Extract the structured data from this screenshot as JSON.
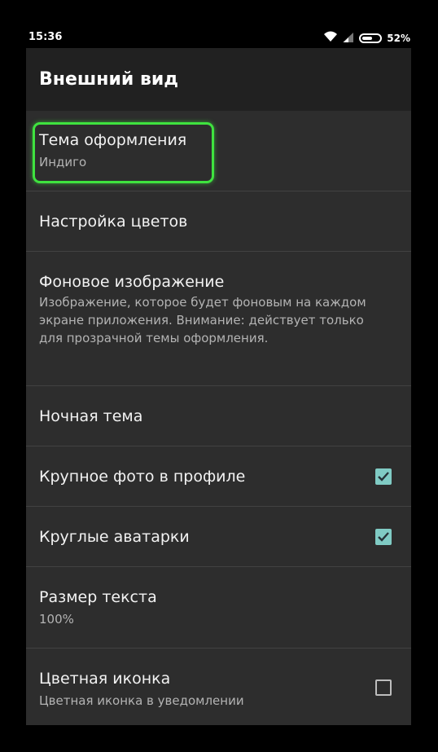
{
  "status_bar": {
    "time": "15:36",
    "battery": "52%"
  },
  "app_bar": {
    "title": "Внешний вид"
  },
  "preferences": [
    {
      "title": "Тема оформления",
      "summary": "Индиго"
    },
    {
      "title": "Настройка цветов"
    },
    {
      "title": "Фоновое изображение",
      "summary": "Изображение, которое будет фоновым на каждом экране приложения. Внимание: действует только для прозрачной темы оформления."
    },
    {
      "title": "Ночная тема"
    },
    {
      "title": "Крупное фото в профиле",
      "checked": true
    },
    {
      "title": "Круглые аватарки",
      "checked": true
    },
    {
      "title": "Размер текста",
      "summary": "100%"
    },
    {
      "title": "Цветная иконка",
      "summary": "Цветная иконка в уведомлении",
      "checked": false
    }
  ],
  "colors": {
    "accent_checkbox": "#80cbc4",
    "highlight": "#3fe23f",
    "background": "#2d2d2d",
    "app_bar": "#212121"
  }
}
